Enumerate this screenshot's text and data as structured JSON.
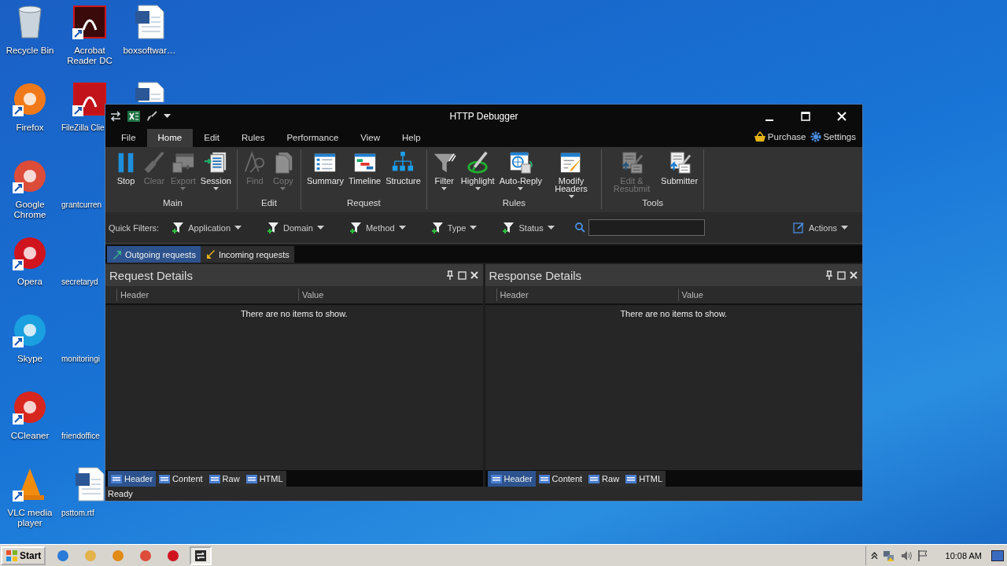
{
  "desktop": {
    "icons": [
      {
        "label": "Recycle Bin"
      },
      {
        "label": "Firefox"
      },
      {
        "label": "Google Chrome"
      },
      {
        "label": "Opera"
      },
      {
        "label": "Skype"
      },
      {
        "label": "CCleaner"
      },
      {
        "label": "VLC media player"
      },
      {
        "label": "Acrobat Reader DC"
      },
      {
        "label": "FileZilla Clie"
      },
      {
        "label": "grantcurren"
      },
      {
        "label": "secretaryd"
      },
      {
        "label": "monitoringi"
      },
      {
        "label": "friendoffice"
      },
      {
        "label": "psttom.rtf"
      },
      {
        "label": "boxsoftwar…"
      }
    ]
  },
  "window": {
    "title": "HTTP Debugger",
    "menu_tabs": [
      {
        "label": "File",
        "selected": false
      },
      {
        "label": "Home",
        "selected": true
      },
      {
        "label": "Edit",
        "selected": false
      },
      {
        "label": "Rules",
        "selected": false
      },
      {
        "label": "Performance",
        "selected": false
      },
      {
        "label": "View",
        "selected": false
      },
      {
        "label": "Help",
        "selected": false
      }
    ],
    "links": [
      "Purchase",
      "Settings"
    ],
    "ribbon": [
      {
        "label": "Main",
        "buttons": [
          {
            "label": "Stop",
            "disabled": false,
            "dropdown": false
          },
          {
            "label": "Clear",
            "disabled": true,
            "dropdown": false
          },
          {
            "label": "Export",
            "disabled": true,
            "dropdown": true
          },
          {
            "label": "Session",
            "disabled": false,
            "dropdown": true
          }
        ]
      },
      {
        "label": "Edit",
        "buttons": [
          {
            "label": "Find",
            "disabled": true,
            "dropdown": false
          },
          {
            "label": "Copy",
            "disabled": true,
            "dropdown": true
          }
        ]
      },
      {
        "label": "Request",
        "buttons": [
          {
            "label": "Summary",
            "disabled": false,
            "dropdown": false
          },
          {
            "label": "Timeline",
            "disabled": false,
            "dropdown": false
          },
          {
            "label": "Structure",
            "disabled": false,
            "dropdown": false
          }
        ]
      },
      {
        "label": "Rules",
        "buttons": [
          {
            "label": "Filter",
            "disabled": false,
            "dropdown": true
          },
          {
            "label": "Highlight",
            "disabled": false,
            "dropdown": true
          },
          {
            "label": "Auto-Reply",
            "disabled": false,
            "dropdown": true
          },
          {
            "label": "Modify Headers",
            "disabled": false,
            "dropdown": true
          }
        ]
      },
      {
        "label": "Tools",
        "buttons": [
          {
            "label": "Edit & Resubmit",
            "disabled": true,
            "dropdown": false
          },
          {
            "label": "Submitter",
            "disabled": false,
            "dropdown": false
          }
        ]
      }
    ],
    "quick_filters": {
      "label": "Quick Filters:",
      "filters": [
        "Application",
        "Domain",
        "Method",
        "Type",
        "Status"
      ],
      "actions": "Actions"
    },
    "session_tabs": [
      {
        "label": "Outgoing requests",
        "selected": true
      },
      {
        "label": "Incoming requests",
        "selected": false
      }
    ],
    "panels": [
      {
        "title": "Request Details",
        "columns": [
          "Header",
          "Value"
        ],
        "empty_text": "There are no items to show.",
        "tabs": [
          {
            "label": "Header",
            "selected": true
          },
          {
            "label": "Content",
            "selected": false
          },
          {
            "label": "Raw",
            "selected": false
          },
          {
            "label": "HTML",
            "selected": false
          }
        ]
      },
      {
        "title": "Response Details",
        "columns": [
          "Header",
          "Value"
        ],
        "empty_text": "There are no items to show.",
        "tabs": [
          {
            "label": "Header",
            "selected": true
          },
          {
            "label": "Content",
            "selected": false
          },
          {
            "label": "Raw",
            "selected": false
          },
          {
            "label": "HTML",
            "selected": false
          }
        ]
      }
    ],
    "status_bar": "Ready"
  },
  "taskbar": {
    "start": "Start",
    "items": [
      {
        "active": false
      },
      {
        "active": false
      },
      {
        "active": false
      },
      {
        "active": false
      },
      {
        "active": false
      },
      {
        "active": true
      }
    ],
    "clock": "10:08 AM"
  }
}
